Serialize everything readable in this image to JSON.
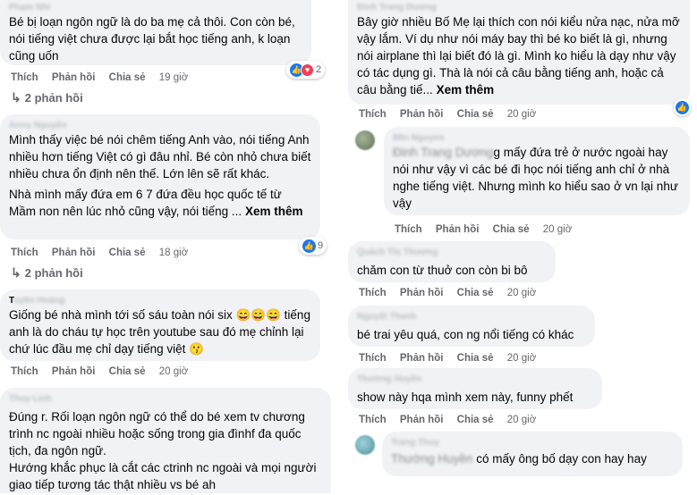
{
  "left": {
    "c1": {
      "author": "Phạm Nhi",
      "text": "Bé bị loạn ngôn ngữ là do ba mẹ cả thôi. Con còn bé, nói tiếng việt chưa được lại bắt học tiếng anh, k loạn cũng uốn",
      "reaction_count": "2",
      "like": "Thích",
      "reply": "Phản hồi",
      "share": "Chia sẻ",
      "time": "19 giờ",
      "replies": "2 phản hồi"
    },
    "c2": {
      "author": "Anny Nguyễn",
      "para1": "Mình thấy việc bé nói chêm tiếng Anh vào, nói tiếng Anh nhiều hơn tiếng Việt có gì đâu nhỉ. Bé còn nhỏ chưa biết nhiều chưa ổn định nên thế. Lớn lên sẽ rất khác.",
      "para2": "Nhà mình mấy đứa em 6 7 đứa đều học quốc tế từ Mầm non nên lúc nhỏ cũng vậy, nói tiếng ...",
      "see_more": "Xem thêm",
      "reaction_count": "9",
      "like": "Thích",
      "reply": "Phản hồi",
      "share": "Chia sẻ",
      "time": "18 giờ",
      "replies": "2 phản hồi"
    },
    "c3": {
      "author_initial": "T",
      "author_rest": "uyền Hoàng",
      "text": "Giống bé nhà mình tới số sáu toàn nói six 😄😄😄 tiếng anh là do cháu tự học trên youtube sau đó mẹ chỉnh lại chứ lúc đầu mẹ chỉ dạy tiếng việt 😗",
      "like": "Thích",
      "reply": "Phản hồi",
      "share": "Chia sẻ",
      "time": "20 giờ"
    },
    "c4": {
      "author": "Thuy Linh",
      "para1": "Đúng r. Rối loạn ngôn ngữ có thể do bé xem tv chương trình nc ngoài nhiều hoặc sống trong gia đìnhf đa quốc tịch, đa ngôn ngữ.",
      "para2": "Hướng khắc phục là cắt các ctrinh nc ngoài và mọi người giao tiếp tương tác thật nhiều vs bé ah"
    }
  },
  "right": {
    "c1": {
      "author": "Đinh Trang Dương",
      "text": "Bây giờ nhiều Bố Mẹ lại thích con nói kiểu nửa nạc, nửa mỡ vậy lắm. Ví dụ như nói máy bay thì bé ko biết là gì, nhưng nói airplane thì lại biết đó là gì. Mình ko hiểu là dạy như vậy có tác dụng gì. Thà là nói cả câu bằng tiếng anh, hoặc cả câu bằng tiế...",
      "see_more": "Xem thêm",
      "like": "Thích",
      "reply": "Phản hồi",
      "share": "Chia sẻ",
      "time": "20 giờ"
    },
    "c2": {
      "author": "Mtn Nguyen",
      "mention": "Đinh Trang Dương",
      "text": "g mấy đứa trẻ ở nước ngoài hay nói như vậy vì các bé đi học nói tiếng anh chỉ ở nhà nghe tiếng việt. Nhưng mình ko hiểu sao ở vn lại như vậy",
      "like": "Thích",
      "reply": "Phản hồi",
      "share": "Chia sẻ",
      "time": "20 giờ"
    },
    "c3": {
      "author": "Quách Thị Thương",
      "text": "chăm con từ thuở con còn bi bô",
      "like": "Thích",
      "reply": "Phản hồi",
      "share": "Chia sẻ",
      "time": "20 giờ"
    },
    "c4": {
      "author": "Nguyệt Thanh",
      "text": "bé trai yêu quá, con ng nổi tiếng có khác",
      "like": "Thích",
      "reply": "Phản hồi",
      "share": "Chia sẻ",
      "time": "20 giờ"
    },
    "c5": {
      "author": "Thường Huyền",
      "text": "show này hqa mình xem này, funny phết",
      "like": "Thích",
      "reply": "Phản hồi",
      "share": "Chia sẻ",
      "time": "20 giờ"
    },
    "c6": {
      "author": "Trang Thuy",
      "mention": "Thường Huyền",
      "text": "có mấy ông bố dạy con hay hay"
    }
  },
  "colors": {
    "bubble": "#f0f2f5",
    "meta": "#65676b",
    "like_blue": "#1877f2",
    "love_red": "#f33e58"
  },
  "icons": [
    "reply-arrow-icon",
    "like-reaction-icon",
    "love-reaction-icon",
    "avatar"
  ]
}
